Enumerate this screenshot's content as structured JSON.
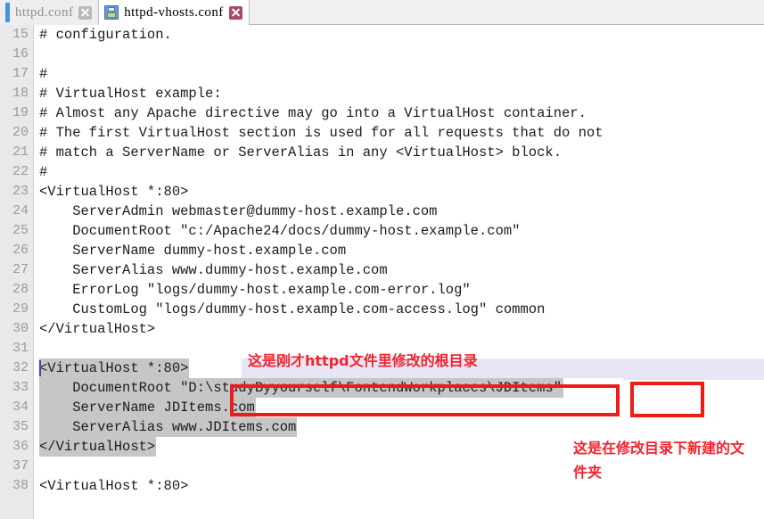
{
  "window": {
    "type": "text-editor",
    "colors": {
      "annotation_red": "#f5222d",
      "box_red": "#ee1b1b",
      "selection_gray": "#c6c6c6",
      "current_line": "#e6e6f7",
      "gutter_bg": "#e9e9e9",
      "tab_accent_blue": "#3f94e0"
    }
  },
  "tabs": [
    {
      "label": "httpd.conf",
      "active": false,
      "icon": "accent-bar-icon",
      "close_icon": "close-icon",
      "close_style": "gray"
    },
    {
      "label": "httpd-vhosts.conf",
      "active": true,
      "icon": "save-floppy-icon",
      "close_icon": "close-icon",
      "close_style": "red"
    }
  ],
  "editor": {
    "first_line_number": 15,
    "lines": [
      {
        "n": 15,
        "text": "# configuration."
      },
      {
        "n": 16,
        "text": ""
      },
      {
        "n": 17,
        "text": "#"
      },
      {
        "n": 18,
        "text": "# VirtualHost example:"
      },
      {
        "n": 19,
        "text": "# Almost any Apache directive may go into a VirtualHost container."
      },
      {
        "n": 20,
        "text": "# The first VirtualHost section is used for all requests that do not"
      },
      {
        "n": 21,
        "text": "# match a ServerName or ServerAlias in any <VirtualHost> block."
      },
      {
        "n": 22,
        "text": "#"
      },
      {
        "n": 23,
        "text": "<VirtualHost *:80>"
      },
      {
        "n": 24,
        "text": "    ServerAdmin webmaster@dummy-host.example.com"
      },
      {
        "n": 25,
        "text": "    DocumentRoot \"c:/Apache24/docs/dummy-host.example.com\""
      },
      {
        "n": 26,
        "text": "    ServerName dummy-host.example.com"
      },
      {
        "n": 27,
        "text": "    ServerAlias www.dummy-host.example.com"
      },
      {
        "n": 28,
        "text": "    ErrorLog \"logs/dummy-host.example.com-error.log\""
      },
      {
        "n": 29,
        "text": "    CustomLog \"logs/dummy-host.example.com-access.log\" common"
      },
      {
        "n": 30,
        "text": "</VirtualHost>"
      },
      {
        "n": 31,
        "text": ""
      },
      {
        "n": 32,
        "text": "<VirtualHost *:80>"
      },
      {
        "n": 33,
        "text": "    DocumentRoot \"D:\\studyByyourself\\FontendWorkplaces\\JDItems\""
      },
      {
        "n": 34,
        "text": "    ServerName JDItems.com"
      },
      {
        "n": 35,
        "text": "    ServerAlias www.JDItems.com"
      },
      {
        "n": 36,
        "text": "</VirtualHost>"
      },
      {
        "n": 37,
        "text": ""
      },
      {
        "n": 38,
        "text": "<VirtualHost *:80>"
      }
    ]
  },
  "annotations": [
    {
      "id": "root-dir",
      "text": "这是刚才httpd文件里修改的根目录"
    },
    {
      "id": "new-folder",
      "text": "这是在修改目录下新建的文件夹"
    }
  ],
  "highlight_boxes": [
    {
      "id": "path",
      "encloses": "D:\\studyByyourself\\FontendWorkplaces"
    },
    {
      "id": "folder",
      "encloses": "JDItems"
    }
  ]
}
